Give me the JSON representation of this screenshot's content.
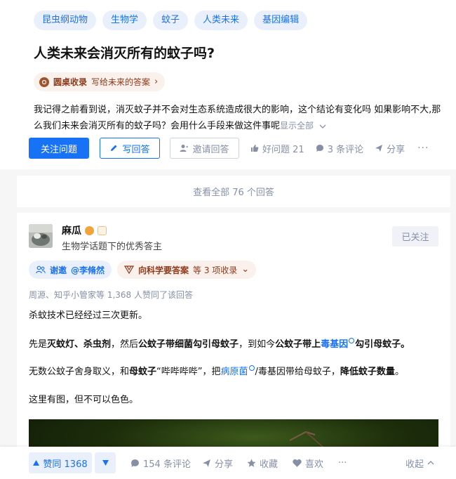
{
  "question": {
    "tags": [
      "昆虫纲动物",
      "生物学",
      "蚊子",
      "人类未来",
      "基因编辑"
    ],
    "title": "人类未来会消灭所有的蚊子吗?",
    "roundtable": {
      "label": "圆桌收录",
      "text": "写给未来的答案",
      "arrow": "›"
    },
    "description": "我记得之前看到说，消灭蚊子并不会对生态系统造成很大的影响，这个结论有变化吗 如果影响不大,那么我们未来会消灭所有的蚊子吗？会用什么手段来做这件事呢",
    "show_all": "显示全部",
    "actions": {
      "follow": "关注问题",
      "write": "写回答",
      "invite": "邀请回答",
      "good_question": "好问题 21",
      "comments": "3 条评论",
      "share": "分享",
      "more": "···"
    }
  },
  "view_all_answers": "查看全部 76 个回答",
  "answer": {
    "author": {
      "name": "麻瓜",
      "description": "生物学话题下的优秀答主",
      "follow_status": "已关注"
    },
    "invite": {
      "prefix": "谢邀",
      "mention": "@李脩然"
    },
    "collect": {
      "label": "向科学要答案",
      "suffix": "等 3 项收录",
      "chevron": "⌄"
    },
    "agree_line": "周源、知乎小管家等 1,368 人赞同了该回答",
    "paragraphs": {
      "p1": "杀蚊技术已经经过三次更新。",
      "p2_a": "先是",
      "p2_b": "灭蚊灯、杀虫剂",
      "p2_c": "，然后",
      "p2_d": "公蚊子带细菌勾引母蚊子",
      "p2_e": "，到如今",
      "p2_f": "公蚊子带上",
      "p2_link": "毒基因",
      "p2_g": "勾引母蚊子。",
      "p3_a": "无数公蚊子舍身取义，和",
      "p3_b": "母蚊子",
      "p3_c": "“哔哔哔哔”，把",
      "p3_link": "病原菌",
      "p3_d": "/毒基因带给母蚊子，",
      "p3_e": "降低蚊子数量",
      "p3_f": "。",
      "p4": "这里有图，但不可以色色。"
    }
  },
  "bottom_bar": {
    "upvote": "赞同 1368",
    "comments": "154 条评论",
    "share": "分享",
    "favorite": "收藏",
    "like": "喜欢",
    "more": "···",
    "collapse": "收起"
  },
  "colors": {
    "accent": "#1772f6",
    "tag_bg": "#eaf0fb",
    "roundtable_bg": "#fbf1ec",
    "muted": "#8590a6"
  }
}
